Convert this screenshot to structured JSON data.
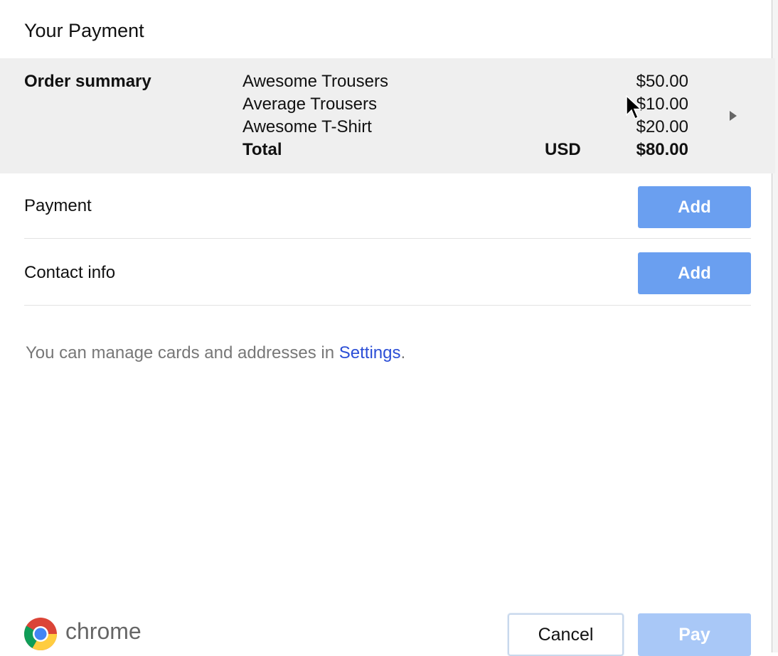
{
  "dialog": {
    "title": "Your Payment"
  },
  "order_summary": {
    "label": "Order summary",
    "items": [
      {
        "name": "Awesome Trousers",
        "price": "$50.00"
      },
      {
        "name": "Average Trousers",
        "price": "$10.00"
      },
      {
        "name": "Awesome T-Shirt",
        "price": "$20.00"
      }
    ],
    "total_label": "Total",
    "currency": "USD",
    "total": "$80.00"
  },
  "payment": {
    "label": "Payment",
    "add_label": "Add"
  },
  "contact_info": {
    "label": "Contact info",
    "add_label": "Add"
  },
  "settings_note": {
    "prefix": "You can manage cards and addresses in ",
    "link_text": "Settings",
    "suffix": "."
  },
  "footer": {
    "brand": "chrome",
    "cancel_label": "Cancel",
    "pay_label": "Pay"
  },
  "colors": {
    "primary_button": "#6a9ff0",
    "disabled_button": "#a9c8f7",
    "link": "#2b4ed6",
    "summary_background": "#efefef"
  }
}
